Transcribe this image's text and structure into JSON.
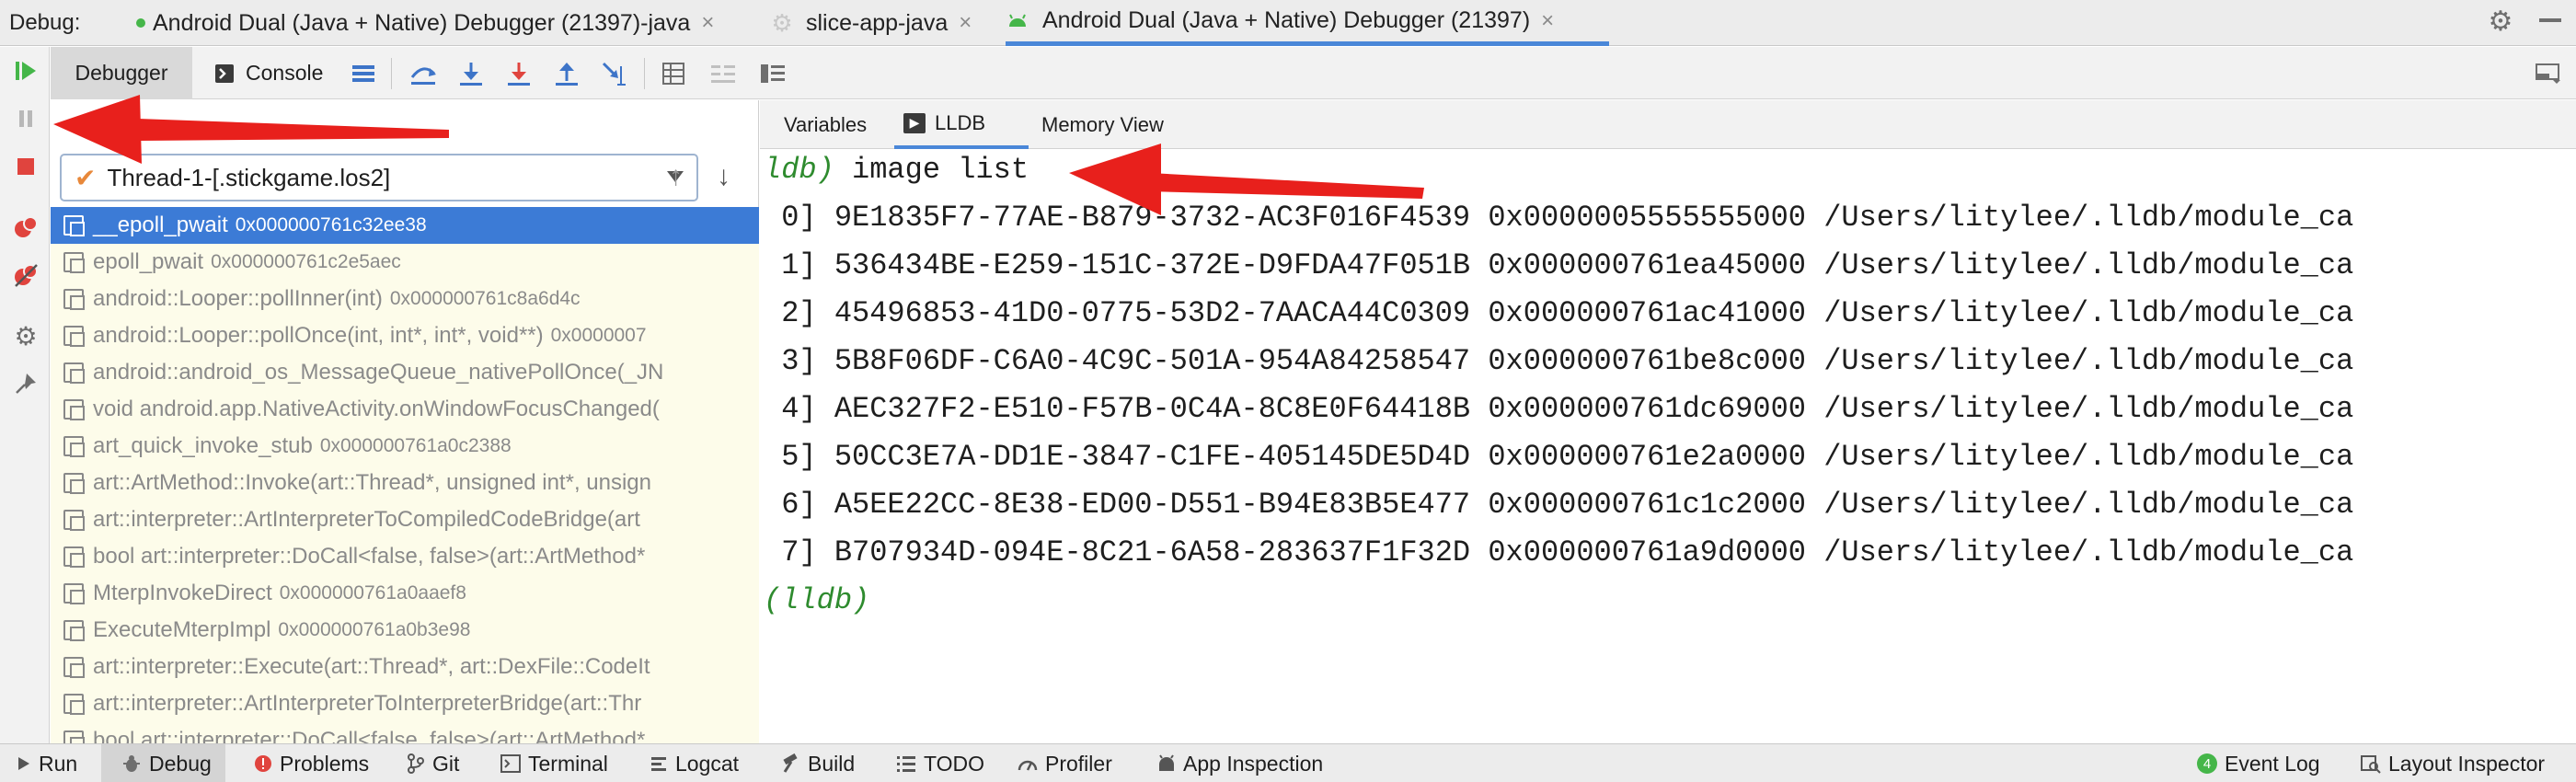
{
  "tabbar": {
    "debug_label": "Debug:",
    "tabs": [
      {
        "label": "Android Dual (Java + Native) Debugger (21397)-java"
      },
      {
        "label": "slice-app-java"
      },
      {
        "label": "Android Dual (Java + Native) Debugger (21397)"
      }
    ],
    "close_glyph": "×"
  },
  "toolbar": {
    "debugger_label": "Debugger",
    "console_label": "Console"
  },
  "frames": {
    "thread_label": "Thread-1-[.stickgame.los2]",
    "items": [
      {
        "name": "__epoll_pwait",
        "addr": "0x000000761c32ee38"
      },
      {
        "name": "epoll_pwait",
        "addr": "0x000000761c2e5aec"
      },
      {
        "name": "android::Looper::pollInner(int)",
        "addr": "0x000000761c8a6d4c"
      },
      {
        "name": "android::Looper::pollOnce(int, int*, int*, void**)",
        "addr": "0x0000007"
      },
      {
        "name": "android::android_os_MessageQueue_nativePollOnce(_JN",
        "addr": ""
      },
      {
        "name": "void android.app.NativeActivity.onWindowFocusChanged(",
        "addr": ""
      },
      {
        "name": "art_quick_invoke_stub",
        "addr": "0x000000761a0c2388"
      },
      {
        "name": "art::ArtMethod::Invoke(art::Thread*, unsigned int*, unsign",
        "addr": ""
      },
      {
        "name": "art::interpreter::ArtInterpreterToCompiledCodeBridge(art",
        "addr": ""
      },
      {
        "name": "bool art::interpreter::DoCall<false, false>(art::ArtMethod*",
        "addr": ""
      },
      {
        "name": "MterpInvokeDirect",
        "addr": "0x000000761a0aaef8"
      },
      {
        "name": "ExecuteMterpImpl",
        "addr": "0x000000761a0b3e98"
      },
      {
        "name": "art::interpreter::Execute(art::Thread*, art::DexFile::CodeIt",
        "addr": ""
      },
      {
        "name": "art::interpreter::ArtInterpreterToInterpreterBridge(art::Thr",
        "addr": ""
      },
      {
        "name": "bool art::interpreter::DoCall<false, false>(art::ArtMethod*",
        "addr": ""
      }
    ]
  },
  "subtabs": {
    "variables": "Variables",
    "lldb": "LLDB",
    "memory": "Memory View"
  },
  "console": {
    "first_prompt": "ldb)",
    "command": " image list",
    "lines": [
      " 0] 9E1835F7-77AE-B879-3732-AC3F016F4539 0x0000005555555000 /Users/litylee/.lldb/module_ca",
      " 1] 536434BE-E259-151C-372E-D9FDA47F051B 0x000000761ea45000 /Users/litylee/.lldb/module_ca",
      " 2] 45496853-41D0-0775-53D2-7AACA44C0309 0x000000761ac41000 /Users/litylee/.lldb/module_ca",
      " 3] 5B8F06DF-C6A0-4C9C-501A-954A84258547 0x000000761be8c000 /Users/litylee/.lldb/module_ca",
      " 4] AEC327F2-E510-F57B-0C4A-8C8E0F64418B 0x000000761dc69000 /Users/litylee/.lldb/module_ca",
      " 5] 50CC3E7A-DD1E-3847-C1FE-405145DE5D4D 0x000000761e2a0000 /Users/litylee/.lldb/module_ca",
      " 6] A5EE22CC-8E38-ED00-D551-B94E83B5E477 0x000000761c1c2000 /Users/litylee/.lldb/module_ca",
      " 7] B707934D-094E-8C21-6A58-283637F1F32D 0x000000761a9d0000 /Users/litylee/.lldb/module_ca"
    ],
    "last_prompt": "(lldb)"
  },
  "statusbar": {
    "run": "Run",
    "debug": "Debug",
    "problems": "Problems",
    "git": "Git",
    "terminal": "Terminal",
    "logcat": "Logcat",
    "build": "Build",
    "todo": "TODO",
    "profiler": "Profiler",
    "app_inspection": "App Inspection",
    "event_log_count": "4",
    "event_log": "Event Log",
    "layout_inspector": "Layout Inspector"
  },
  "colors": {
    "accent": "#4a87d8",
    "selected_frame": "#3c7bd6",
    "frames_bg": "#fdfcea",
    "prompt_green": "#2e8b2e",
    "annotation_red": "#e8201c"
  }
}
